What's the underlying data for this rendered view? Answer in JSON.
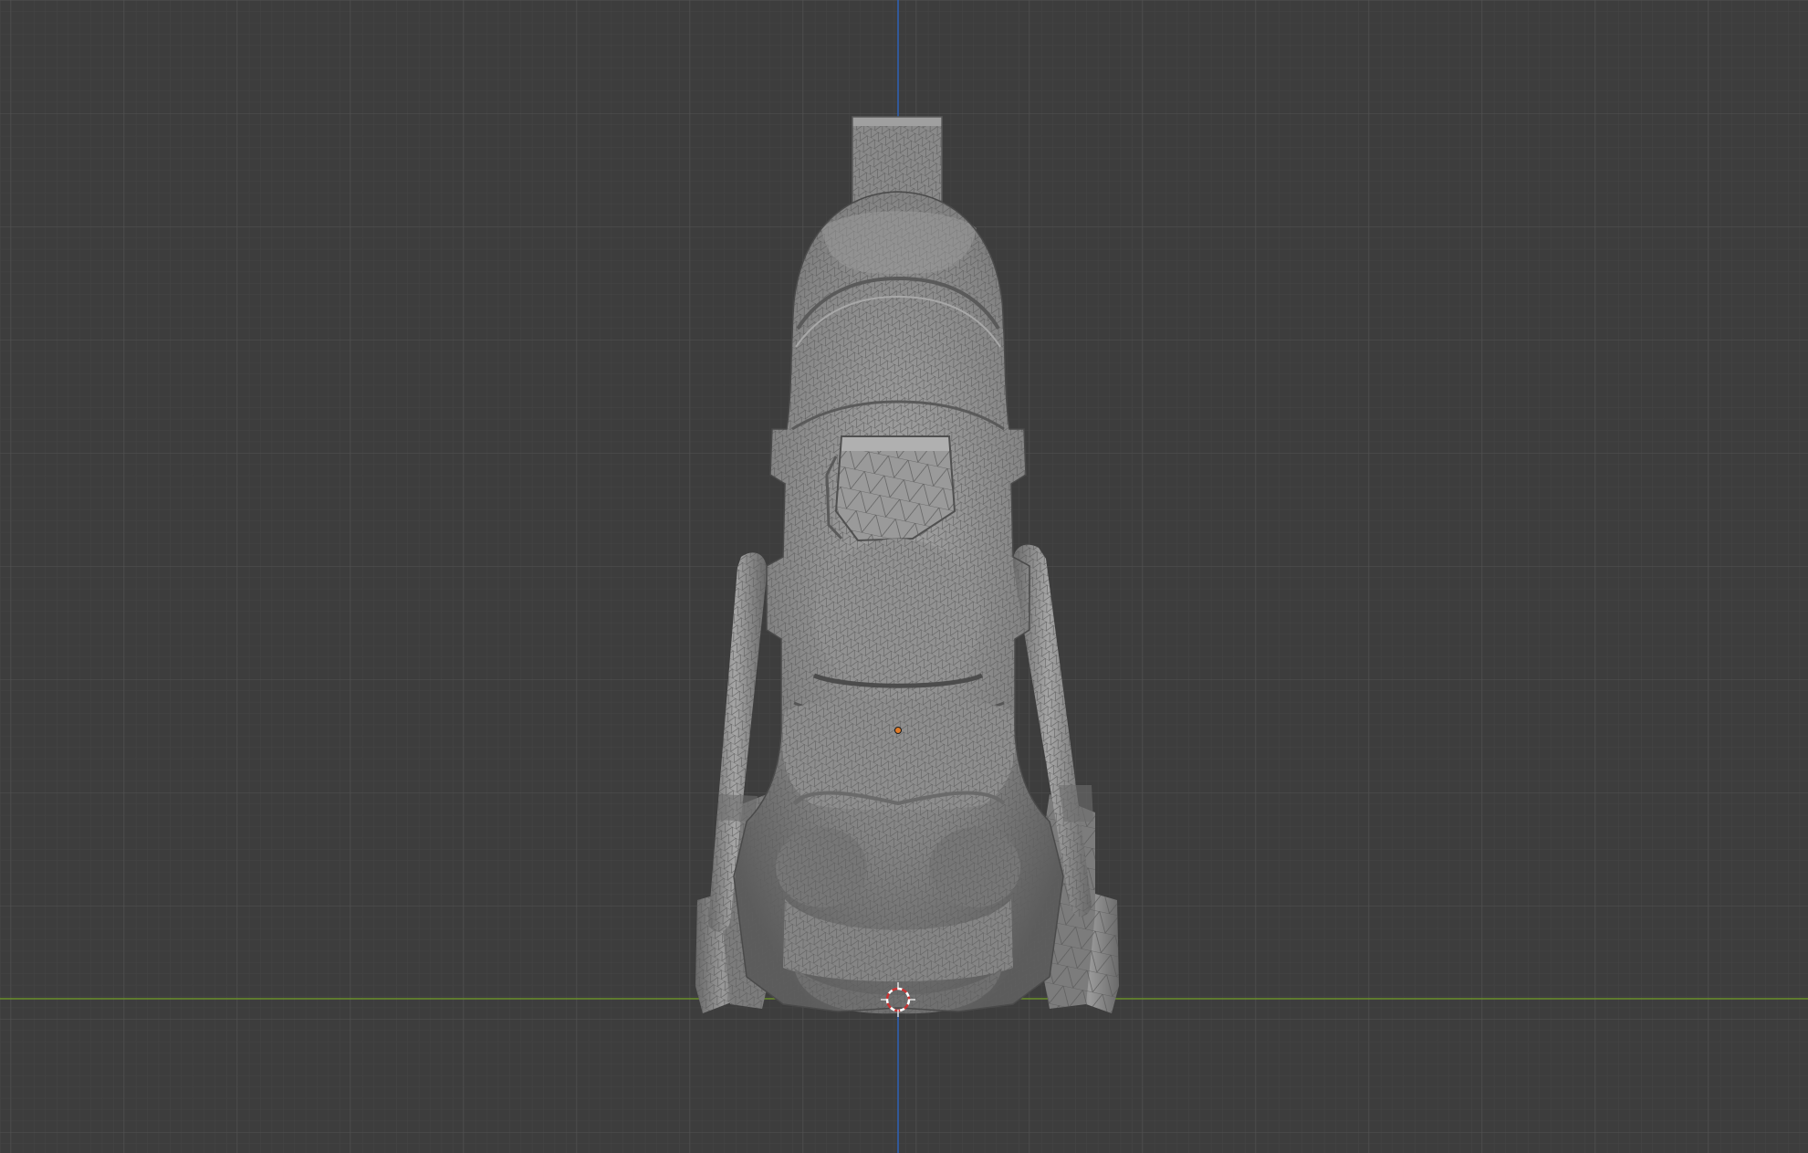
{
  "app": {
    "name": "3D viewport",
    "view": "front-orthographic"
  },
  "viewport": {
    "background_color": "#3d3d3d",
    "grid_minor_color": "#444444",
    "grid_major_color": "#4e4e4e",
    "axis_x_color": "#6a8f2a",
    "axis_z_color": "#2f5fb0"
  },
  "object": {
    "type": "triangulated-mesh",
    "display_mode": "solid-with-wireframe",
    "base_color": "#8a8a8a",
    "highlight_color": "#a8a8a8",
    "shadow_color": "#555555"
  },
  "markers": {
    "origin_color": "#e07b28",
    "cursor_color": "#cc3333"
  }
}
